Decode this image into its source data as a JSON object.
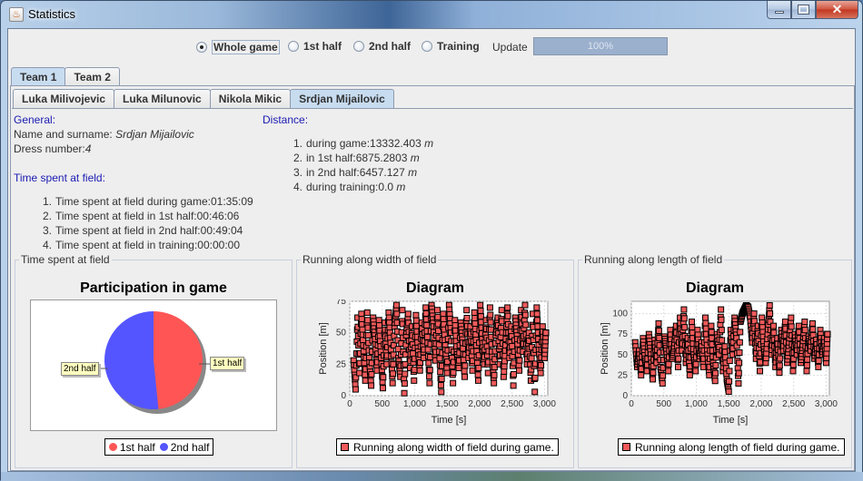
{
  "window": {
    "title": "Statistics",
    "controls": {
      "minimize": "minimize",
      "maximize": "maximize",
      "close": "✕"
    }
  },
  "filters": {
    "options": [
      {
        "label": "Whole game",
        "selected": true
      },
      {
        "label": "1st half",
        "selected": false
      },
      {
        "label": "2nd half",
        "selected": false
      },
      {
        "label": "Training",
        "selected": false
      }
    ],
    "update_label": "Update",
    "progress_text": "100%",
    "progress_value": 1.0
  },
  "team_tabs": [
    {
      "label": "Team 1",
      "selected": true
    },
    {
      "label": "Team 2",
      "selected": false
    }
  ],
  "player_tabs": [
    {
      "label": "Luka Milivojevic",
      "selected": false
    },
    {
      "label": "Luka Milunovic",
      "selected": false
    },
    {
      "label": "Nikola Mikic",
      "selected": false
    },
    {
      "label": "Srdjan Mijailovic",
      "selected": true
    }
  ],
  "general": {
    "heading": "General:",
    "name_label": "Name and surname: ",
    "name_value": "Srdjan Mijailovic",
    "dress_label": "Dress number:",
    "dress_value": "4"
  },
  "time_spent": {
    "heading": "Time spent at field:",
    "items": [
      {
        "num": "1.",
        "text": "Time spent at field during game:01:35:09"
      },
      {
        "num": "2.",
        "text": "Time spent at field in 1st half:00:46:06"
      },
      {
        "num": "3.",
        "text": "Time spent at field in 2nd half:00:49:04"
      },
      {
        "num": "4.",
        "text": "Time spent at field in training:00:00:00"
      }
    ]
  },
  "distance": {
    "heading": "Distance:",
    "unit": "m",
    "items": [
      {
        "num": "1.",
        "text": "during game:13332.403 "
      },
      {
        "num": "2.",
        "text": "in 1st half:6875.2803 "
      },
      {
        "num": "3.",
        "text": "in 2nd half:6457.127 "
      },
      {
        "num": "4.",
        "text": "during training:0.0 "
      }
    ]
  },
  "panels": {
    "pie_group_title": "Time spent at field",
    "width_group_title": "Running along width of field",
    "length_group_title": "Running along length of field"
  },
  "chart_data": [
    {
      "type": "pie",
      "title": "Participation in game",
      "categories": [
        "1st half",
        "2nd half"
      ],
      "values": [
        48.4,
        51.6
      ],
      "colors": [
        "#ff5555",
        "#5555ff"
      ],
      "legend": [
        "1st half",
        "2nd half"
      ],
      "legend_position": "bottom",
      "labels": [
        "1st half",
        "2nd half"
      ]
    },
    {
      "type": "scatter",
      "title": "Diagram",
      "xlabel": "Time [s]",
      "ylabel": "Position [m]",
      "xlim": [
        0,
        3050
      ],
      "ylim": [
        0,
        75
      ],
      "xticks": [
        "0",
        "500",
        "1,000",
        "1,500",
        "2,000",
        "2,500",
        "3,000"
      ],
      "xtick_values": [
        0,
        500,
        1000,
        1500,
        2000,
        2500,
        3000
      ],
      "yticks": [
        "0",
        "25",
        "50",
        "75"
      ],
      "ytick_values": [
        0,
        25,
        50,
        75
      ],
      "grid": true,
      "legend": [
        "Running along width of field during game."
      ],
      "legend_position": "bottom",
      "series": [
        {
          "name": "Running along width of field during game.",
          "color": "#f05a5a",
          "x": [
            60,
            90,
            120,
            150,
            180,
            210,
            240,
            270,
            300,
            330,
            360,
            390,
            420,
            450,
            480,
            510,
            540,
            570,
            600,
            630,
            660,
            690,
            720,
            750,
            780,
            810,
            840,
            870,
            900,
            930,
            960,
            990,
            1020,
            1050,
            1080,
            1110,
            1140,
            1170,
            1200,
            1230,
            1260,
            1290,
            1320,
            1350,
            1380,
            1410,
            1440,
            1470,
            1500,
            1530,
            1560,
            1590,
            1620,
            1650,
            1680,
            1710,
            1740,
            1770,
            1800,
            1830,
            1860,
            1890,
            1920,
            1950,
            1980,
            2010,
            2040,
            2070,
            2100,
            2130,
            2160,
            2190,
            2220,
            2250,
            2280,
            2310,
            2340,
            2370,
            2400,
            2430,
            2460,
            2490,
            2520,
            2550,
            2580,
            2610,
            2640,
            2670,
            2700,
            2730,
            2760,
            2790,
            2820,
            2850,
            2880,
            2910,
            2940,
            2970,
            3000,
            3020
          ],
          "y": [
            28,
            5,
            62,
            18,
            65,
            40,
            12,
            66,
            30,
            8,
            62,
            45,
            20,
            60,
            35,
            6,
            58,
            25,
            66,
            42,
            10,
            55,
            72,
            30,
            15,
            68,
            2,
            48,
            65,
            22,
            55,
            12,
            64,
            38,
            20,
            58,
            30,
            70,
            42,
            10,
            72,
            55,
            28,
            68,
            35,
            3,
            65,
            40,
            18,
            72,
            50,
            10,
            60,
            35,
            22,
            58,
            42,
            15,
            68,
            30,
            55,
            20,
            66,
            40,
            12,
            72,
            45,
            25,
            60,
            18,
            70,
            35,
            10,
            48,
            62,
            25,
            68,
            15,
            40,
            70,
            30,
            55,
            8,
            62,
            45,
            20,
            68,
            35,
            72,
            25,
            50,
            12,
            65,
            3,
            70,
            40,
            18,
            55,
            30,
            50
          ]
        }
      ]
    },
    {
      "type": "scatter",
      "title": "Diagram",
      "xlabel": "Time [s]",
      "ylabel": "Position [m]",
      "xlim": [
        0,
        3050
      ],
      "ylim": [
        0,
        115
      ],
      "xticks": [
        "0",
        "500",
        "1,000",
        "1,500",
        "2,000",
        "2,500",
        "3,000"
      ],
      "xtick_values": [
        0,
        500,
        1000,
        1500,
        2000,
        2500,
        3000
      ],
      "yticks": [
        "0",
        "25",
        "50",
        "75",
        "100"
      ],
      "ytick_values": [
        0,
        25,
        50,
        75,
        100
      ],
      "grid": true,
      "legend": [
        "Running along length of field during game."
      ],
      "legend_position": "bottom",
      "series": [
        {
          "name": "Running along length of field during game.",
          "color": "#f05a5a",
          "x": [
            60,
            90,
            120,
            150,
            180,
            210,
            240,
            270,
            300,
            330,
            360,
            390,
            420,
            450,
            480,
            510,
            540,
            570,
            600,
            630,
            660,
            690,
            720,
            750,
            780,
            810,
            840,
            870,
            900,
            930,
            960,
            990,
            1020,
            1050,
            1080,
            1110,
            1140,
            1170,
            1200,
            1230,
            1260,
            1290,
            1320,
            1350,
            1380,
            1410,
            1440,
            1470,
            1500,
            1530,
            1560,
            1590,
            1620,
            1650,
            1680,
            1710,
            1740,
            1770,
            1800,
            1830,
            1860,
            1890,
            1920,
            1950,
            1980,
            2010,
            2040,
            2070,
            2100,
            2130,
            2160,
            2190,
            2220,
            2250,
            2280,
            2310,
            2340,
            2370,
            2400,
            2430,
            2460,
            2490,
            2520,
            2550,
            2580,
            2610,
            2640,
            2670,
            2700,
            2730,
            2760,
            2790,
            2820,
            2850,
            2880,
            2910,
            2940,
            2970,
            3000,
            3020
          ],
          "y": [
            65,
            35,
            55,
            25,
            70,
            45,
            30,
            75,
            50,
            20,
            68,
            40,
            88,
            35,
            15,
            72,
            55,
            30,
            80,
            45,
            60,
            85,
            35,
            95,
            55,
            105,
            40,
            70,
            25,
            90,
            50,
            30,
            80,
            45,
            65,
            35,
            95,
            55,
            25,
            85,
            40,
            18,
            75,
            50,
            105,
            30,
            60,
            20,
            5,
            80,
            50,
            95,
            70,
            15,
            90,
            100,
            105,
            110,
            108,
            95,
            65,
            100,
            45,
            85,
            30,
            95,
            60,
            40,
            75,
            110,
            50,
            85,
            35,
            70,
            28,
            80,
            55,
            90,
            40,
            65,
            95,
            30,
            75,
            50,
            85,
            40,
            62,
            90,
            30,
            72,
            55,
            88,
            45,
            68,
            35,
            80,
            50,
            70,
            40,
            75
          ]
        }
      ]
    }
  ]
}
